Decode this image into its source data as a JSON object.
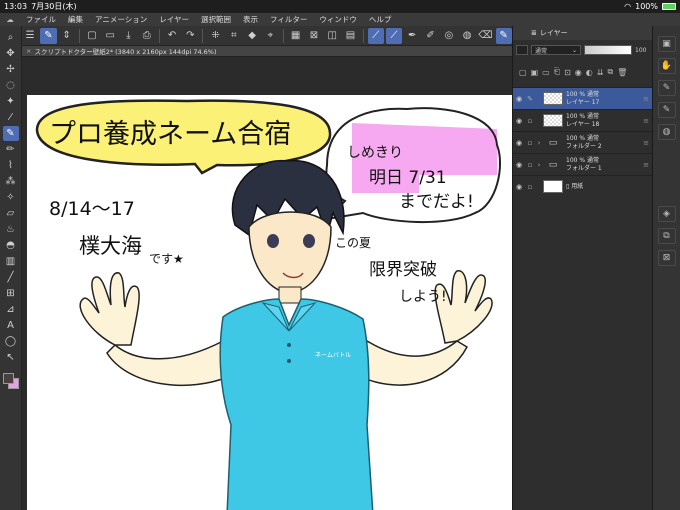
{
  "status_bar": {
    "time": "13:03",
    "date": "7月30日(木)",
    "battery_percent": "100%",
    "battery_level": 1.0,
    "battery_color": "#5fd35f"
  },
  "menu": {
    "items": [
      "ファイル",
      "編集",
      "アニメーション",
      "レイヤー",
      "選択範囲",
      "表示",
      "フィルター",
      "ウィンドウ",
      "ヘルプ"
    ]
  },
  "toolbar": {
    "icons": [
      "menu-icon",
      "drawing-mode-icon",
      "new-icon",
      "open-icon",
      "save-icon",
      "print-icon",
      "undo-icon",
      "redo-icon",
      "lasso-fill-icon",
      "transform-icon",
      "bucket-icon",
      "crop-icon",
      "clear-icon",
      "invert-icon",
      "select-icon",
      "ruler-icon",
      "pen-stabilizer-icon",
      "brush-icon",
      "edit-icon",
      "eraser-icon",
      "settings-icon"
    ]
  },
  "document_tab": {
    "title": "スクリプトドクター壁紙2* (3840 x 2160px 144dpi 74.6%)"
  },
  "tools": {
    "foreground_color": "#4a4040",
    "background_color": "#e9a0e9"
  },
  "layer_panel": {
    "tab_label": "レイヤー",
    "blend_mode": "通常",
    "opacity": "100",
    "layers": [
      {
        "opacity_mode": "100 % 通常",
        "name": "レイヤー 17",
        "selected": true,
        "kind": "layer"
      },
      {
        "opacity_mode": "100 % 通常",
        "name": "レイヤー 18",
        "selected": false,
        "kind": "layer"
      },
      {
        "opacity_mode": "100 % 通常",
        "name": "フォルダー 2",
        "selected": false,
        "kind": "folder"
      },
      {
        "opacity_mode": "100 % 通常",
        "name": "フォルダー 1",
        "selected": false,
        "kind": "folder"
      },
      {
        "opacity_mode": "",
        "name": "用紙",
        "selected": false,
        "kind": "paper"
      }
    ]
  },
  "artwork": {
    "bubble_title": "プロ養成ネーム合宿",
    "dates": "8/14〜17",
    "place": "樸大海",
    "place_suffix": "です★",
    "deadline_line1": "しめきり",
    "deadline_line2": "明日 7/31",
    "deadline_line3": "までだよ!",
    "summer_line1": "この夏",
    "summer_line2": "限界突破",
    "summer_line3": "しよう!",
    "shirt_logo": "ネームバトル",
    "bubble_color": "#fbf176",
    "shirt_color": "#3fc8e6",
    "pink_color": "#f6a8f0"
  }
}
